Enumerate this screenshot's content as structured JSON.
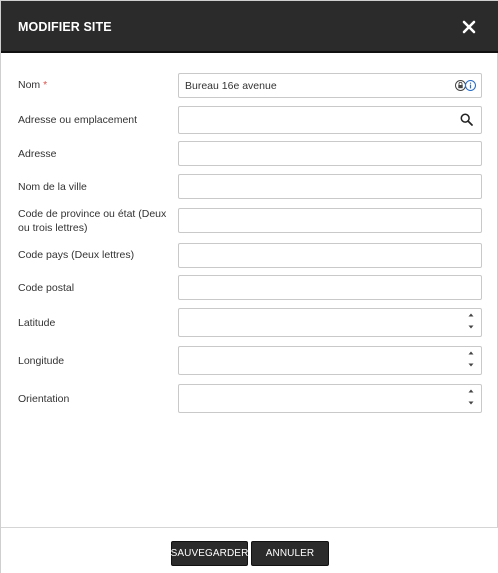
{
  "dialog": {
    "title": "MODIFIER SITE",
    "close_icon": "close-icon"
  },
  "fields": {
    "nom": {
      "label": "Nom",
      "required_mark": "*",
      "value": "Bureau 16e avenue",
      "icons": [
        "lock-icon",
        "info-icon"
      ]
    },
    "adresse_ou_emplacement": {
      "label": "Adresse ou emplacement",
      "value": "",
      "icon": "search-icon"
    },
    "adresse": {
      "label": "Adresse",
      "value": ""
    },
    "nom_ville": {
      "label": "Nom de la ville",
      "value": ""
    },
    "code_province": {
      "label": "Code de province ou état (Deux ou trois lettres)",
      "value": ""
    },
    "code_pays": {
      "label": "Code pays (Deux lettres)",
      "value": ""
    },
    "code_postal": {
      "label": "Code postal",
      "value": ""
    },
    "latitude": {
      "label": "Latitude",
      "value": ""
    },
    "longitude": {
      "label": "Longitude",
      "value": ""
    },
    "orientation": {
      "label": "Orientation",
      "value": ""
    }
  },
  "footer": {
    "save_label": "SAUVEGARDER",
    "cancel_label": "ANNULER"
  },
  "colors": {
    "header_bg": "#2b2b2b",
    "required": "#d9534f",
    "info_blue": "#2a6fc9"
  }
}
